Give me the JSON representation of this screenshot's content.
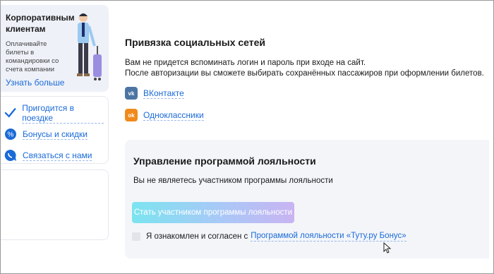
{
  "sidebar": {
    "promo": {
      "title": "Корпоративным клиентам",
      "text": "Оплачивайте билеты в командировки со счета компании",
      "link": "Узнать больше"
    },
    "menu": [
      {
        "label": "Пригодится в поездке",
        "icon": "check-icon"
      },
      {
        "label": "Бонусы и скидки",
        "icon": "percent-badge-icon"
      },
      {
        "label": "Связаться с нами",
        "icon": "chat-icon"
      }
    ]
  },
  "social": {
    "title": "Привязка социальных сетей",
    "desc_line1": "Вам не придется вспоминать логин и пароль при входе на сайт.",
    "desc_line2": "После авторизации вы сможете выбирать сохранённых пассажиров при оформлении билетов.",
    "networks": [
      {
        "label": "ВКонтакте",
        "icon": "vk-icon",
        "icon_text": "vk",
        "color": "#4c75a3"
      },
      {
        "label": "Одноклассники",
        "icon": "ok-icon",
        "icon_text": "ok",
        "color": "#f08a1c"
      }
    ]
  },
  "loyalty": {
    "title": "Управление программой лояльности",
    "status": "Вы не являетесь участником программы лояльности",
    "join_button": "Стать участником программы лояльности",
    "agree_text": "Я ознакомлен и согласен с",
    "agree_link": "Программой лояльности «Туту.ру Бонус»"
  },
  "colors": {
    "link": "#1a6ad8",
    "panel": "#f3f5f9"
  }
}
